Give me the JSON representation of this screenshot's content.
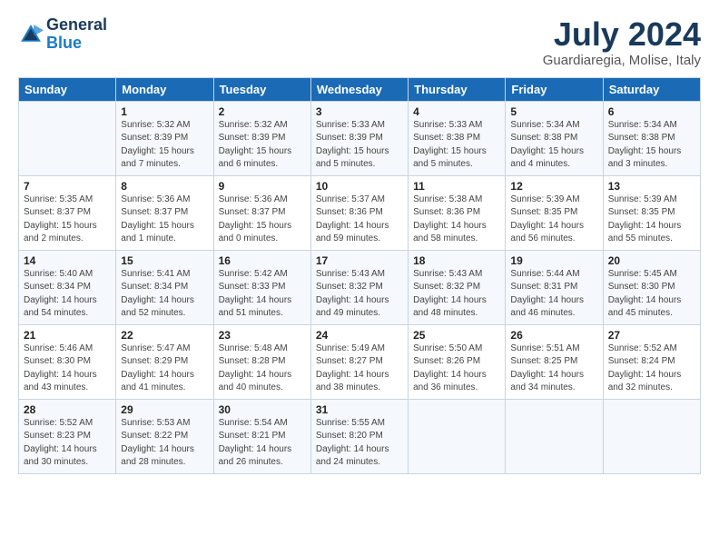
{
  "logo": {
    "line1": "General",
    "line2": "Blue"
  },
  "title": "July 2024",
  "location": "Guardiaregia, Molise, Italy",
  "days_of_week": [
    "Sunday",
    "Monday",
    "Tuesday",
    "Wednesday",
    "Thursday",
    "Friday",
    "Saturday"
  ],
  "weeks": [
    [
      {
        "day": "",
        "detail": ""
      },
      {
        "day": "1",
        "detail": "Sunrise: 5:32 AM\nSunset: 8:39 PM\nDaylight: 15 hours\nand 7 minutes."
      },
      {
        "day": "2",
        "detail": "Sunrise: 5:32 AM\nSunset: 8:39 PM\nDaylight: 15 hours\nand 6 minutes."
      },
      {
        "day": "3",
        "detail": "Sunrise: 5:33 AM\nSunset: 8:39 PM\nDaylight: 15 hours\nand 5 minutes."
      },
      {
        "day": "4",
        "detail": "Sunrise: 5:33 AM\nSunset: 8:38 PM\nDaylight: 15 hours\nand 5 minutes."
      },
      {
        "day": "5",
        "detail": "Sunrise: 5:34 AM\nSunset: 8:38 PM\nDaylight: 15 hours\nand 4 minutes."
      },
      {
        "day": "6",
        "detail": "Sunrise: 5:34 AM\nSunset: 8:38 PM\nDaylight: 15 hours\nand 3 minutes."
      }
    ],
    [
      {
        "day": "7",
        "detail": "Sunrise: 5:35 AM\nSunset: 8:37 PM\nDaylight: 15 hours\nand 2 minutes."
      },
      {
        "day": "8",
        "detail": "Sunrise: 5:36 AM\nSunset: 8:37 PM\nDaylight: 15 hours\nand 1 minute."
      },
      {
        "day": "9",
        "detail": "Sunrise: 5:36 AM\nSunset: 8:37 PM\nDaylight: 15 hours\nand 0 minutes."
      },
      {
        "day": "10",
        "detail": "Sunrise: 5:37 AM\nSunset: 8:36 PM\nDaylight: 14 hours\nand 59 minutes."
      },
      {
        "day": "11",
        "detail": "Sunrise: 5:38 AM\nSunset: 8:36 PM\nDaylight: 14 hours\nand 58 minutes."
      },
      {
        "day": "12",
        "detail": "Sunrise: 5:39 AM\nSunset: 8:35 PM\nDaylight: 14 hours\nand 56 minutes."
      },
      {
        "day": "13",
        "detail": "Sunrise: 5:39 AM\nSunset: 8:35 PM\nDaylight: 14 hours\nand 55 minutes."
      }
    ],
    [
      {
        "day": "14",
        "detail": "Sunrise: 5:40 AM\nSunset: 8:34 PM\nDaylight: 14 hours\nand 54 minutes."
      },
      {
        "day": "15",
        "detail": "Sunrise: 5:41 AM\nSunset: 8:34 PM\nDaylight: 14 hours\nand 52 minutes."
      },
      {
        "day": "16",
        "detail": "Sunrise: 5:42 AM\nSunset: 8:33 PM\nDaylight: 14 hours\nand 51 minutes."
      },
      {
        "day": "17",
        "detail": "Sunrise: 5:43 AM\nSunset: 8:32 PM\nDaylight: 14 hours\nand 49 minutes."
      },
      {
        "day": "18",
        "detail": "Sunrise: 5:43 AM\nSunset: 8:32 PM\nDaylight: 14 hours\nand 48 minutes."
      },
      {
        "day": "19",
        "detail": "Sunrise: 5:44 AM\nSunset: 8:31 PM\nDaylight: 14 hours\nand 46 minutes."
      },
      {
        "day": "20",
        "detail": "Sunrise: 5:45 AM\nSunset: 8:30 PM\nDaylight: 14 hours\nand 45 minutes."
      }
    ],
    [
      {
        "day": "21",
        "detail": "Sunrise: 5:46 AM\nSunset: 8:30 PM\nDaylight: 14 hours\nand 43 minutes."
      },
      {
        "day": "22",
        "detail": "Sunrise: 5:47 AM\nSunset: 8:29 PM\nDaylight: 14 hours\nand 41 minutes."
      },
      {
        "day": "23",
        "detail": "Sunrise: 5:48 AM\nSunset: 8:28 PM\nDaylight: 14 hours\nand 40 minutes."
      },
      {
        "day": "24",
        "detail": "Sunrise: 5:49 AM\nSunset: 8:27 PM\nDaylight: 14 hours\nand 38 minutes."
      },
      {
        "day": "25",
        "detail": "Sunrise: 5:50 AM\nSunset: 8:26 PM\nDaylight: 14 hours\nand 36 minutes."
      },
      {
        "day": "26",
        "detail": "Sunrise: 5:51 AM\nSunset: 8:25 PM\nDaylight: 14 hours\nand 34 minutes."
      },
      {
        "day": "27",
        "detail": "Sunrise: 5:52 AM\nSunset: 8:24 PM\nDaylight: 14 hours\nand 32 minutes."
      }
    ],
    [
      {
        "day": "28",
        "detail": "Sunrise: 5:52 AM\nSunset: 8:23 PM\nDaylight: 14 hours\nand 30 minutes."
      },
      {
        "day": "29",
        "detail": "Sunrise: 5:53 AM\nSunset: 8:22 PM\nDaylight: 14 hours\nand 28 minutes."
      },
      {
        "day": "30",
        "detail": "Sunrise: 5:54 AM\nSunset: 8:21 PM\nDaylight: 14 hours\nand 26 minutes."
      },
      {
        "day": "31",
        "detail": "Sunrise: 5:55 AM\nSunset: 8:20 PM\nDaylight: 14 hours\nand 24 minutes."
      },
      {
        "day": "",
        "detail": ""
      },
      {
        "day": "",
        "detail": ""
      },
      {
        "day": "",
        "detail": ""
      }
    ]
  ]
}
